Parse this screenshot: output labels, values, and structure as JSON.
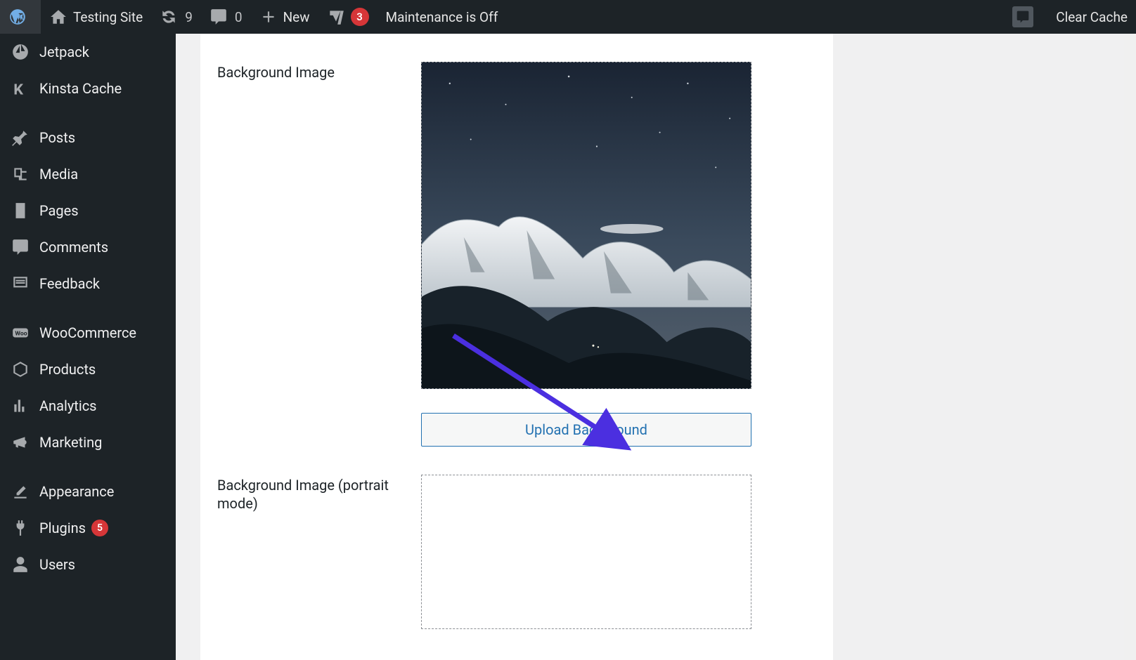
{
  "adminbar": {
    "site_name": "Testing Site",
    "updates_count": "9",
    "comments_count": "0",
    "new_label": "New",
    "yoast_count": "3",
    "maintenance_label": "Maintenance is Off",
    "clear_cache_label": "Clear Cache"
  },
  "sidebar": {
    "items": [
      {
        "key": "jetpack",
        "label": "Jetpack",
        "icon": "jetpack"
      },
      {
        "key": "kinsta",
        "label": "Kinsta Cache",
        "icon": "kinsta"
      },
      {
        "key": "sep"
      },
      {
        "key": "posts",
        "label": "Posts",
        "icon": "pin"
      },
      {
        "key": "media",
        "label": "Media",
        "icon": "media"
      },
      {
        "key": "pages",
        "label": "Pages",
        "icon": "page"
      },
      {
        "key": "comments",
        "label": "Comments",
        "icon": "comment"
      },
      {
        "key": "feedback",
        "label": "Feedback",
        "icon": "feedback"
      },
      {
        "key": "sep"
      },
      {
        "key": "woocommerce",
        "label": "WooCommerce",
        "icon": "woo"
      },
      {
        "key": "products",
        "label": "Products",
        "icon": "box"
      },
      {
        "key": "analytics",
        "label": "Analytics",
        "icon": "bars"
      },
      {
        "key": "marketing",
        "label": "Marketing",
        "icon": "megaphone"
      },
      {
        "key": "sep"
      },
      {
        "key": "appearance",
        "label": "Appearance",
        "icon": "brush"
      },
      {
        "key": "plugins",
        "label": "Plugins",
        "icon": "plug",
        "badge": "5"
      },
      {
        "key": "users",
        "label": "Users",
        "icon": "user"
      }
    ]
  },
  "settings": {
    "bg_label": "Background Image",
    "upload_button": "Upload Background",
    "bg_portrait_label": "Background Image (portrait mode)"
  }
}
